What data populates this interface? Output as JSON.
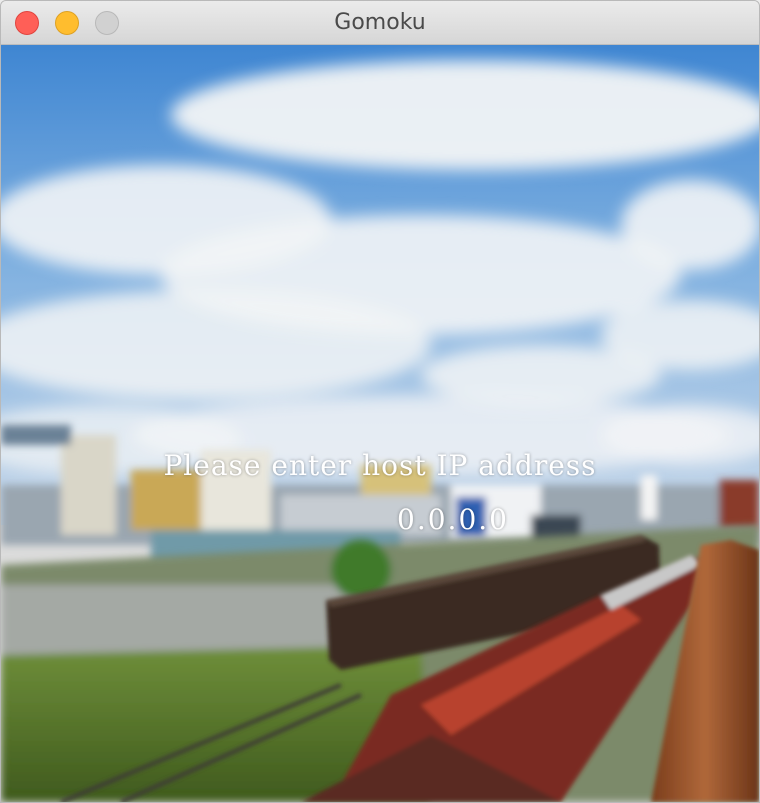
{
  "window": {
    "title": "Gomoku"
  },
  "prompt": {
    "label": "Please enter host IP address",
    "ip_value": "0.0.0.0"
  },
  "background": {
    "description_icon": "railway-harbor-photo"
  }
}
